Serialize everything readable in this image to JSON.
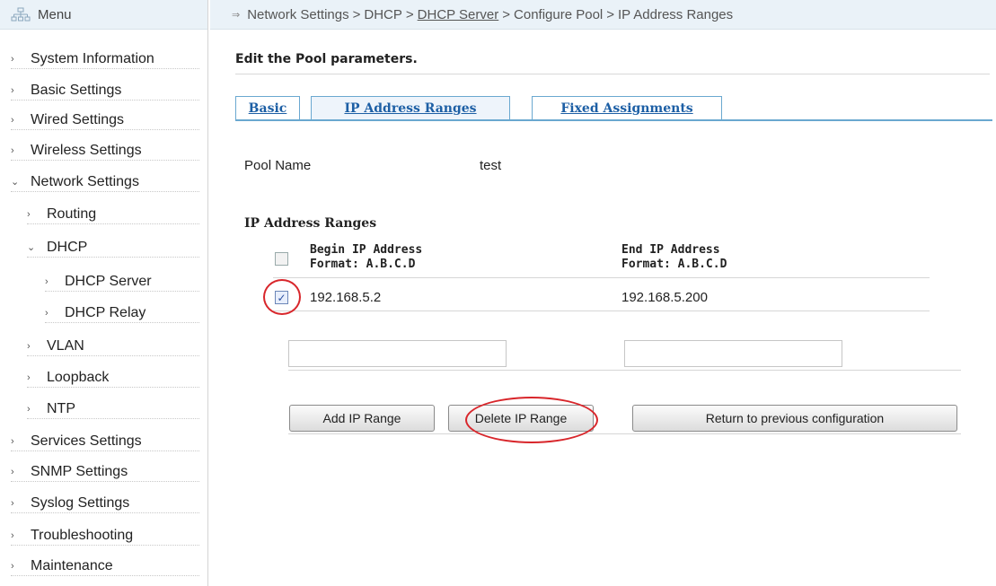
{
  "sidebar": {
    "title": "Menu",
    "items": [
      {
        "label": "System Information",
        "level": 0,
        "expanded": false
      },
      {
        "label": "Basic Settings",
        "level": 0,
        "expanded": false
      },
      {
        "label": "Wired Settings",
        "level": 0,
        "expanded": false
      },
      {
        "label": "Wireless Settings",
        "level": 0,
        "expanded": false
      },
      {
        "label": "Network Settings",
        "level": 0,
        "expanded": true
      },
      {
        "label": "Routing",
        "level": 1,
        "expanded": false
      },
      {
        "label": "DHCP",
        "level": 1,
        "expanded": true
      },
      {
        "label": "DHCP Server",
        "level": 2,
        "expanded": false
      },
      {
        "label": "DHCP Relay",
        "level": 2,
        "expanded": false
      },
      {
        "label": "VLAN",
        "level": 1,
        "expanded": false
      },
      {
        "label": "Loopback",
        "level": 1,
        "expanded": false
      },
      {
        "label": "NTP",
        "level": 1,
        "expanded": false
      },
      {
        "label": "Services Settings",
        "level": 0,
        "expanded": false
      },
      {
        "label": "SNMP Settings",
        "level": 0,
        "expanded": false
      },
      {
        "label": "Syslog Settings",
        "level": 0,
        "expanded": false
      },
      {
        "label": "Troubleshooting",
        "level": 0,
        "expanded": false
      },
      {
        "label": "Maintenance",
        "level": 0,
        "expanded": false
      }
    ]
  },
  "breadcrumb": {
    "arrow": "⇒",
    "parts": [
      "Network Settings",
      "DHCP",
      "DHCP Server",
      "Configure Pool",
      "IP Address Ranges"
    ],
    "separator": ">"
  },
  "page": {
    "title": "Edit the Pool parameters."
  },
  "tabs": [
    {
      "label": "Basic",
      "active": false
    },
    {
      "label": "IP Address Ranges",
      "active": true
    },
    {
      "label": "Fixed Assignments",
      "active": false
    }
  ],
  "pool": {
    "name_label": "Pool Name",
    "name_value": "test"
  },
  "ranges": {
    "title": "IP Address Ranges",
    "begin_header": "Begin IP Address",
    "begin_format": "Format: A.B.C.D",
    "end_header": "End IP Address",
    "end_format": "Format: A.B.C.D",
    "rows": [
      {
        "begin": "192.168.5.2",
        "end": "192.168.5.200",
        "checked": true
      }
    ],
    "new_begin_value": "",
    "new_end_value": ""
  },
  "buttons": {
    "add": "Add IP Range",
    "delete": "Delete IP Range",
    "return": "Return to previous configuration"
  },
  "colors": {
    "accent": "#1d5fa5",
    "tab_border": "#6aa8d0",
    "header_bg": "#eaf2f8",
    "annotation": "#d8262b"
  }
}
